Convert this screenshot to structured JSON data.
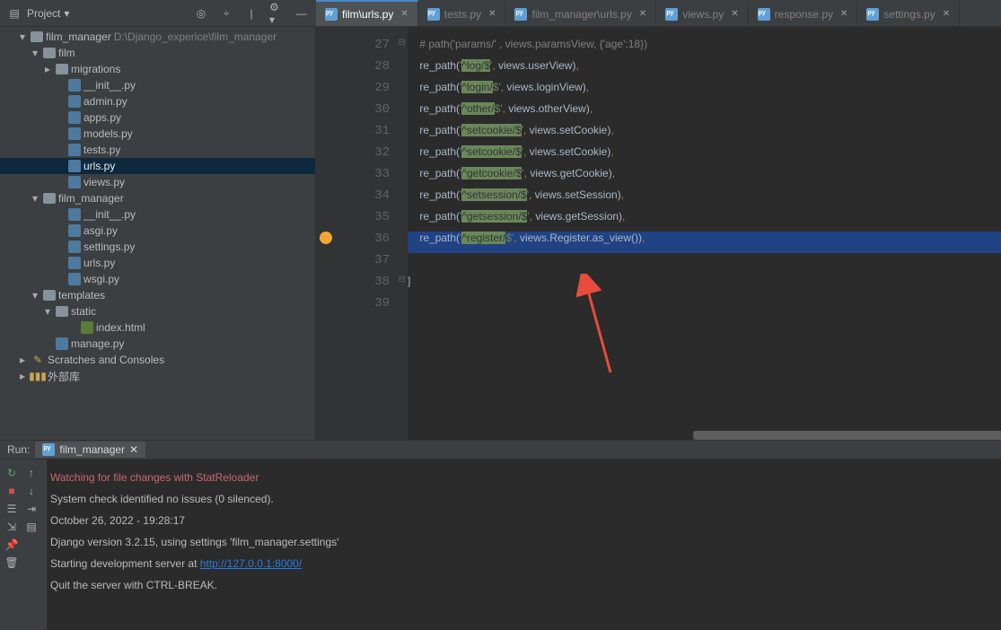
{
  "header": {
    "project_label": "Project",
    "toolbar_icons": [
      "target-icon",
      "collapse-icon",
      "divider",
      "gear-icon",
      "minimize-icon"
    ]
  },
  "tabs": [
    {
      "label": "film\\urls.py",
      "active": true
    },
    {
      "label": "tests.py",
      "active": false
    },
    {
      "label": "film_manager\\urls.py",
      "active": false
    },
    {
      "label": "views.py",
      "active": false
    },
    {
      "label": "response.py",
      "active": false
    },
    {
      "label": "settings.py",
      "active": false
    }
  ],
  "tree": [
    {
      "ind": 0,
      "ch": "▾",
      "ic": "fo",
      "t": "film_manager",
      "ext": "  D:\\Django_experice\\film_manager"
    },
    {
      "ind": 1,
      "ch": "▾",
      "ic": "fo",
      "t": "film"
    },
    {
      "ind": 2,
      "ch": "▸",
      "ic": "fo",
      "t": "migrations"
    },
    {
      "ind": 3,
      "ch": "",
      "ic": "pf",
      "t": "__init__.py"
    },
    {
      "ind": 3,
      "ch": "",
      "ic": "pf",
      "t": "admin.py"
    },
    {
      "ind": 3,
      "ch": "",
      "ic": "pf",
      "t": "apps.py"
    },
    {
      "ind": 3,
      "ch": "",
      "ic": "pf",
      "t": "models.py"
    },
    {
      "ind": 3,
      "ch": "",
      "ic": "pf",
      "t": "tests.py"
    },
    {
      "ind": 3,
      "ch": "",
      "ic": "pf",
      "t": "urls.py",
      "sel": true
    },
    {
      "ind": 3,
      "ch": "",
      "ic": "pf",
      "t": "views.py"
    },
    {
      "ind": 1,
      "ch": "▾",
      "ic": "fo",
      "t": "film_manager"
    },
    {
      "ind": 3,
      "ch": "",
      "ic": "pf",
      "t": "__init__.py"
    },
    {
      "ind": 3,
      "ch": "",
      "ic": "pf",
      "t": "asgi.py"
    },
    {
      "ind": 3,
      "ch": "",
      "ic": "pf",
      "t": "settings.py"
    },
    {
      "ind": 3,
      "ch": "",
      "ic": "pf",
      "t": "urls.py"
    },
    {
      "ind": 3,
      "ch": "",
      "ic": "pf",
      "t": "wsgi.py"
    },
    {
      "ind": 1,
      "ch": "▾",
      "ic": "fo",
      "t": "templates"
    },
    {
      "ind": 2,
      "ch": "▾",
      "ic": "fo",
      "t": "static"
    },
    {
      "ind": 4,
      "ch": "",
      "ic": "ht",
      "t": "index.html"
    },
    {
      "ind": 2,
      "ch": "",
      "ic": "pf",
      "t": "manage.py"
    },
    {
      "ind": 0,
      "ch": "▸",
      "ic": "sc",
      "t": "Scratches and Consoles"
    },
    {
      "ind": 0,
      "ch": "▸",
      "ic": "lib",
      "t": "外部库"
    }
  ],
  "lines": [
    27,
    28,
    29,
    30,
    31,
    32,
    33,
    34,
    35,
    36,
    37,
    38,
    39
  ],
  "code": [
    {
      "n": 27,
      "seg": [
        {
          "c": "cmt",
          "t": "# path('params/' , views.paramsView, {'age':18})"
        }
      ]
    },
    {
      "n": 28,
      "seg": [
        {
          "c": "fn",
          "t": "re_path("
        },
        {
          "c": "str",
          "t": "'"
        },
        {
          "c": "olive",
          "t": "^log/$"
        },
        {
          "c": "str",
          "t": "'"
        },
        {
          "c": "op",
          "t": ", "
        },
        {
          "c": "fn",
          "t": "views.userView)"
        },
        {
          "c": "op",
          "t": ","
        }
      ]
    },
    {
      "n": 29,
      "seg": [
        {
          "c": "fn",
          "t": "re_path("
        },
        {
          "c": "str",
          "t": "'"
        },
        {
          "c": "olive",
          "t": "^login/"
        },
        {
          "c": "str",
          "t": "$'"
        },
        {
          "c": "op",
          "t": ", "
        },
        {
          "c": "fn",
          "t": "views.loginView)"
        },
        {
          "c": "op",
          "t": ","
        }
      ]
    },
    {
      "n": 30,
      "seg": [
        {
          "c": "fn",
          "t": "re_path("
        },
        {
          "c": "str",
          "t": "'"
        },
        {
          "c": "olive",
          "t": "^other/"
        },
        {
          "c": "str",
          "t": "$'"
        },
        {
          "c": "op",
          "t": ", "
        },
        {
          "c": "fn",
          "t": "views.otherView)"
        },
        {
          "c": "op",
          "t": ","
        }
      ]
    },
    {
      "n": 31,
      "seg": [
        {
          "c": "fn",
          "t": "re_path("
        },
        {
          "c": "str",
          "t": "'"
        },
        {
          "c": "olive",
          "t": "^setcookie/$"
        },
        {
          "c": "str",
          "t": "'"
        },
        {
          "c": "op",
          "t": ", "
        },
        {
          "c": "fn",
          "t": "views.setCookie)"
        },
        {
          "c": "op",
          "t": ","
        }
      ]
    },
    {
      "n": 32,
      "seg": [
        {
          "c": "fn",
          "t": "re_path("
        },
        {
          "c": "str",
          "t": "'"
        },
        {
          "c": "olive",
          "t": "^setcookie/$"
        },
        {
          "c": "str",
          "t": "'"
        },
        {
          "c": "op",
          "t": ", "
        },
        {
          "c": "fn",
          "t": "views.setCookie)"
        },
        {
          "c": "op",
          "t": ","
        }
      ]
    },
    {
      "n": 33,
      "seg": [
        {
          "c": "fn",
          "t": "re_path("
        },
        {
          "c": "str",
          "t": "'"
        },
        {
          "c": "olive",
          "t": "^getcookie/$"
        },
        {
          "c": "str",
          "t": "'"
        },
        {
          "c": "op",
          "t": ", "
        },
        {
          "c": "fn",
          "t": "views.getCookie)"
        },
        {
          "c": "op",
          "t": ","
        }
      ]
    },
    {
      "n": 34,
      "seg": [
        {
          "c": "fn",
          "t": "re_path("
        },
        {
          "c": "str",
          "t": "'"
        },
        {
          "c": "olive",
          "t": "^setsession/$"
        },
        {
          "c": "str",
          "t": "'"
        },
        {
          "c": "op",
          "t": ", "
        },
        {
          "c": "fn",
          "t": "views.setSession)"
        },
        {
          "c": "op",
          "t": ","
        }
      ]
    },
    {
      "n": 35,
      "seg": [
        {
          "c": "fn",
          "t": "re_path("
        },
        {
          "c": "str",
          "t": "'"
        },
        {
          "c": "olive",
          "t": "^getsession/$"
        },
        {
          "c": "str",
          "t": "'"
        },
        {
          "c": "op",
          "t": ", "
        },
        {
          "c": "fn",
          "t": "views.getSession)"
        },
        {
          "c": "op",
          "t": ","
        }
      ]
    },
    {
      "n": 36,
      "hl": true,
      "bulb": true,
      "seg": [
        {
          "c": "fn",
          "t": "re_path("
        },
        {
          "c": "str",
          "t": "'"
        },
        {
          "c": "olive",
          "t": "^register/"
        },
        {
          "c": "str",
          "t": "$'"
        },
        {
          "c": "op",
          "t": ", "
        },
        {
          "c": "fn",
          "t": "views.Register.as_view())"
        },
        {
          "c": "op",
          "t": ","
        }
      ]
    },
    {
      "n": 37,
      "seg": []
    },
    {
      "n": 38,
      "seg": [
        {
          "c": "fn",
          "t": "]"
        }
      ],
      "noindent": true
    },
    {
      "n": 39,
      "seg": []
    }
  ],
  "run": {
    "label": "Run:",
    "tab": "film_manager",
    "lines": [
      {
        "cls": "red",
        "t": "Watching for file changes with StatReloader"
      },
      {
        "cls": "",
        "t": "System check identified no issues (0 silenced)."
      },
      {
        "cls": "",
        "t": "October 26, 2022 - 19:28:17"
      },
      {
        "cls": "",
        "t": "Django version 3.2.15, using settings 'film_manager.settings'"
      },
      {
        "cls": "",
        "pre": "Starting development server at ",
        "link": "http://127.0.0.1:8000/"
      },
      {
        "cls": "",
        "t": "Quit the server with CTRL-BREAK."
      }
    ]
  }
}
